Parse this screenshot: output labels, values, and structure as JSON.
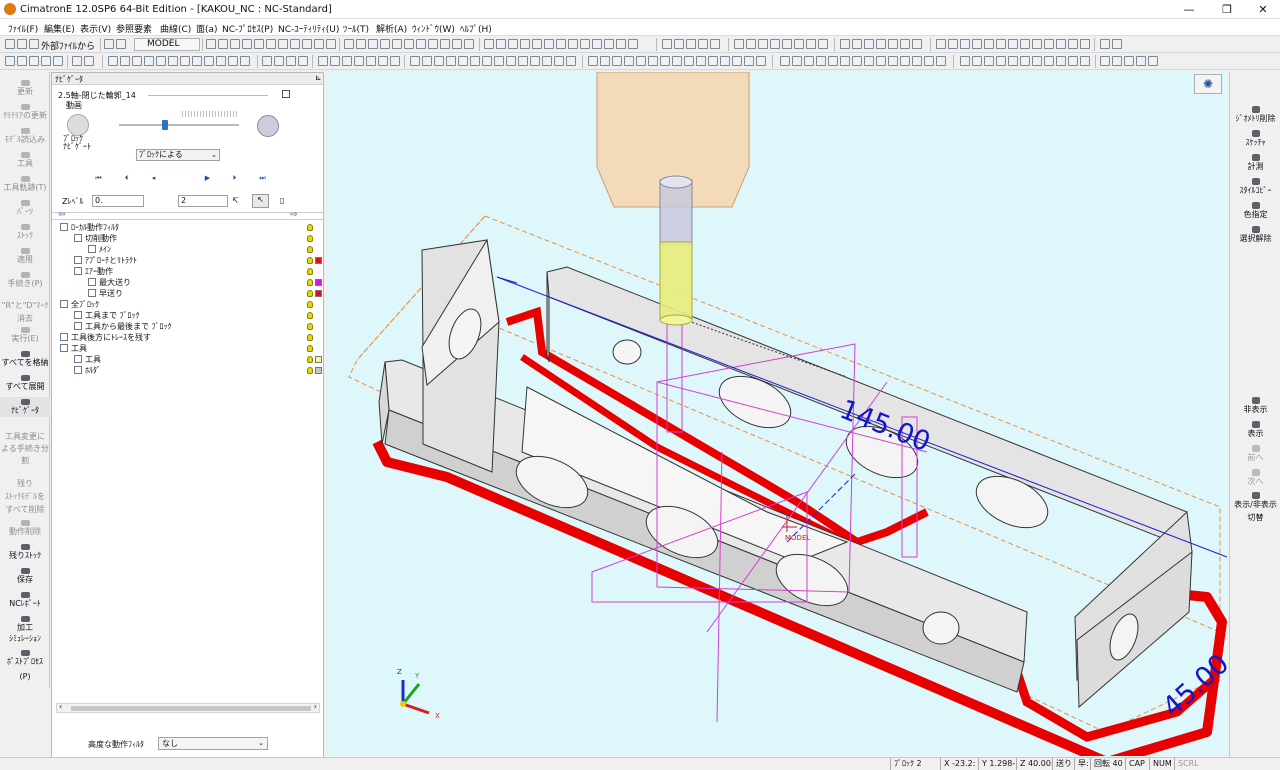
{
  "window": {
    "title": "CimatronE 12.0SP6  64-Bit Edition - [KAKOU_NC : NC-Standard]",
    "minimize": "—",
    "restore": "❐",
    "close": "✕"
  },
  "menubar": [
    {
      "key": "file",
      "label": "ﾌｧｲﾙ(F)"
    },
    {
      "key": "edit",
      "label": "編集(E)"
    },
    {
      "key": "view",
      "label": "表示(V)"
    },
    {
      "key": "ref",
      "label": "参照要素"
    },
    {
      "key": "curve",
      "label": "曲線(C)"
    },
    {
      "key": "face",
      "label": "面(a)"
    },
    {
      "key": "ncprocess",
      "label": "NC-ﾌﾟﾛｾｽ(P)"
    },
    {
      "key": "ncutil",
      "label": "NC-ﾕｰﾃｨﾘﾃｨ(U)"
    },
    {
      "key": "tool",
      "label": "ﾂｰﾙ(T)"
    },
    {
      "key": "analysis",
      "label": "解析(A)"
    },
    {
      "key": "window",
      "label": "ｳｨﾝﾄﾞｳ(W)"
    },
    {
      "key": "help",
      "label": "ﾍﾙﾌﾟ(H)"
    }
  ],
  "toolbar": {
    "external_file": "外部ﾌｧｲﾙから",
    "model_select": "MODEL"
  },
  "leftbar": [
    {
      "label": "更新",
      "state": "dis"
    },
    {
      "label": "ｸﾘﾃﾘｱの更新",
      "state": "dis"
    },
    {
      "label": "ﾓﾃﾞﾙ読込み",
      "state": "dis"
    },
    {
      "label": "工具",
      "state": "dis"
    },
    {
      "label": "工具軌跡(T)",
      "state": "dis"
    },
    {
      "label": "ﾊﾟｰﾂ",
      "state": "dis"
    },
    {
      "label": "ｽﾄｯｸ",
      "state": "dis"
    },
    {
      "label": "適用",
      "state": "dis"
    },
    {
      "label": "手続き(P)",
      "state": "dis"
    },
    {
      "label": "\"R\"と\"D\"ﾏｰｸ",
      "state": "dis"
    },
    {
      "label": "消去",
      "state": "dis"
    },
    {
      "label": "実行(E)",
      "state": "dis"
    },
    {
      "label": "すべてを格納",
      "state": "en"
    },
    {
      "label": "すべて展開",
      "state": "en"
    },
    {
      "label": "ﾅﾋﾞｹﾞｰﾀ",
      "state": "sel"
    },
    {
      "label": "工具変更に",
      "state": "dis"
    },
    {
      "label": "よる手続き分",
      "state": "dis"
    },
    {
      "label": "割",
      "state": "dis"
    },
    {
      "label": "残り",
      "state": "dis"
    },
    {
      "label": "ｽﾄｯｸﾓﾃﾞﾙを",
      "state": "dis"
    },
    {
      "label": "すべて削除",
      "state": "dis"
    },
    {
      "label": "動作削除",
      "state": "dis"
    },
    {
      "label": "残りｽﾄｯｸ",
      "state": "en"
    },
    {
      "label": "保存",
      "state": "en"
    },
    {
      "label": "NCﾚﾎﾟｰﾄ",
      "state": "en"
    },
    {
      "label": "加工",
      "state": "en"
    },
    {
      "label": "ｼﾐｭﾚｰｼｮﾝ",
      "state": "en"
    },
    {
      "label": "ﾎﾟｽﾄﾌﾟﾛｾｽ",
      "state": "en"
    },
    {
      "label": "(P)",
      "state": "en"
    }
  ],
  "navigator": {
    "header": "ﾅﾋﾞｹﾞｰﾀ",
    "procedure": "2.5軸-閉じた輪郭_14",
    "animation_label": "動画",
    "block_label": "ﾌﾞﾛｯｸ",
    "navigate_label": "ﾅﾋﾞｹﾞｰﾄ",
    "mode_select": "ﾌﾞﾛｯｸによる",
    "zlevel_label": "Zﾚﾍﾞﾙ",
    "zlevel_value": "0.",
    "step_value": "2",
    "speed": 0.38,
    "tree": [
      {
        "label": "ﾛｰｶﾙ動作ﾌｨﾙﾀ",
        "depth": 0,
        "color": ""
      },
      {
        "label": "切削動作",
        "depth": 1,
        "color": ""
      },
      {
        "label": "ﾒｲﾝ",
        "depth": 2,
        "color": ""
      },
      {
        "label": "ｱﾌﾟﾛｰﾁとﾘﾄﾗｸﾄ",
        "depth": 1,
        "color": "#e01010"
      },
      {
        "label": "ｴｱｰ動作",
        "depth": 1,
        "color": ""
      },
      {
        "label": "最大送り",
        "depth": 2,
        "color": "#e010e0"
      },
      {
        "label": "早送り",
        "depth": 2,
        "color": "#e01010"
      },
      {
        "label": "全ﾌﾞﾛｯｸ",
        "depth": 0,
        "color": ""
      },
      {
        "label": "工具まで ﾌﾞﾛｯｸ",
        "depth": 1,
        "color": ""
      },
      {
        "label": "工具から最後まで ﾌﾞﾛｯｸ",
        "depth": 1,
        "color": ""
      },
      {
        "label": "工具後方にﾄﾚｰｽを残す",
        "depth": 0,
        "color": ""
      },
      {
        "label": "工具",
        "depth": 0,
        "color": ""
      },
      {
        "label": "工具",
        "depth": 1,
        "color": "#f6f69a"
      },
      {
        "label": "ﾎﾙﾀﾞ",
        "depth": 1,
        "color": "#c8c8c8"
      }
    ],
    "advanced_filter_label": "高度な動作ﾌｨﾙﾀ",
    "advanced_filter_value": "なし"
  },
  "viewport": {
    "dimension_length": "145.00",
    "dimension_width": "45.00",
    "model_label": "MODEL",
    "axis_x": "X",
    "axis_y": "Y",
    "axis_z": "Z"
  },
  "rightbar": [
    {
      "label": "ｼﾞｵﾒﾄﾘ削除",
      "state": "en"
    },
    {
      "label": "ｽｹｯﾁｬ",
      "state": "en"
    },
    {
      "label": "計測",
      "state": "en"
    },
    {
      "label": "ｽﾀｲﾙｺﾋﾟｰ",
      "state": "en"
    },
    {
      "label": "色指定",
      "state": "en"
    },
    {
      "label": "選択解除",
      "state": "en"
    },
    {
      "label": "非表示",
      "state": "en"
    },
    {
      "label": "表示",
      "state": "en"
    },
    {
      "label": "前へ",
      "state": "dis"
    },
    {
      "label": "次へ",
      "state": "dis"
    },
    {
      "label": "表示/非表示",
      "state": "en"
    },
    {
      "label": "切替",
      "state": "en"
    }
  ],
  "statusbar": {
    "block": "ﾌﾞﾛｯｸ 2",
    "x": "X  -23.2:",
    "y": "Y  1.298-",
    "z": "Z  40.00:",
    "feed": "送り",
    "rapid": "早:",
    "rpm": "回転  40",
    "cap": "CAP",
    "num": "NUM",
    "scrl": "SCRL"
  },
  "colors": {
    "toolpath_red": "#e80000",
    "part_face": "#e6e6e6",
    "viewport_bg": "#ddf7fb",
    "dimension_blue": "#1515c8",
    "holder": "#f5d6b0",
    "cutter": "#e8ec7a"
  }
}
